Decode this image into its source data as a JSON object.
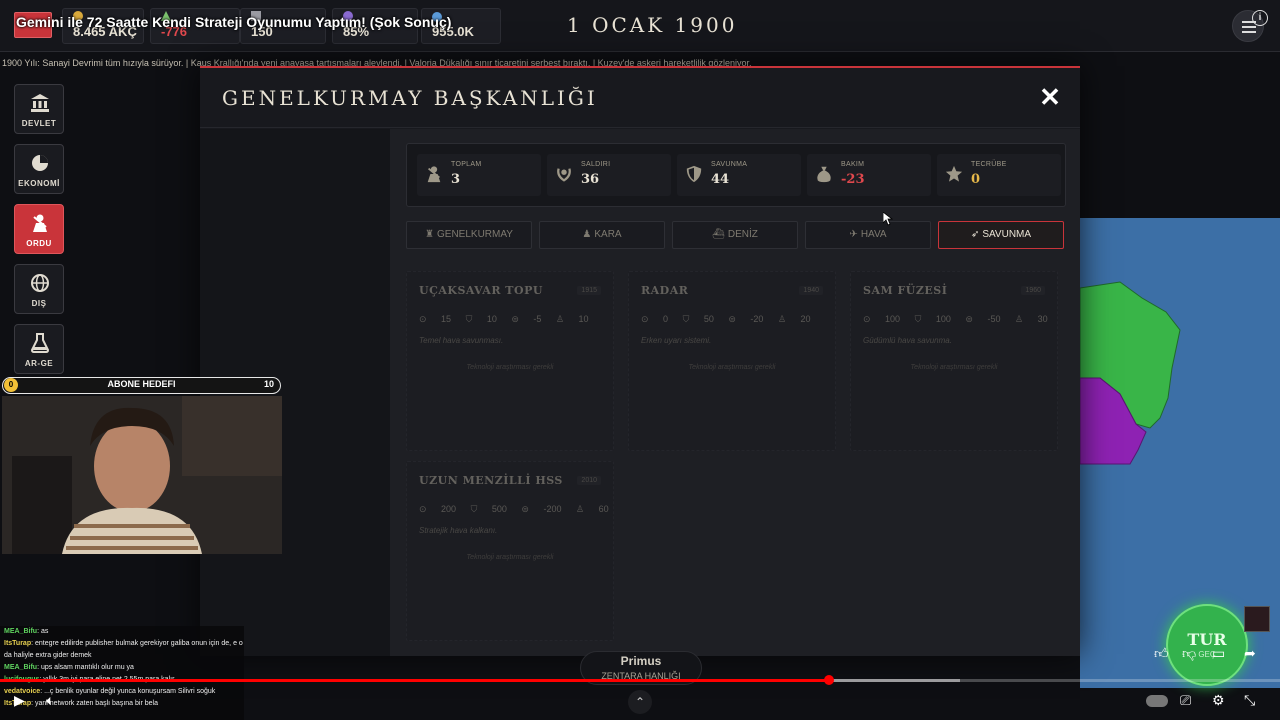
{
  "video": {
    "title": "Gemini ile 72 Saatte Kendi Strateji Oyunumu Yaptım! (Şok Sonuç)",
    "progress_percent": 65,
    "buffer_percent": 75
  },
  "topbar": {
    "resources": [
      {
        "icon": "coins-icon",
        "value": "8.465 AKÇ"
      },
      {
        "icon": "trend-icon",
        "value": "-776"
      },
      {
        "icon": "factory-icon",
        "value": "150"
      },
      {
        "icon": "population-icon",
        "value": "85%"
      },
      {
        "icon": "people-icon",
        "value": "955.0K"
      }
    ],
    "date": "1 OCAK 1900"
  },
  "ticker": "1900 Yılı: Sanayi Devrimi tüm hızıyla sürüyor. | Kaus Krallığı'nda yeni anayasa tartışmaları alevlendi. | Valoria Dükalığı sınır ticaretini serbest bıraktı. | Kuzey'de askeri hareketlilik gözleniyor.",
  "sidebar": {
    "items": [
      {
        "label": "DEVLET",
        "icon": "bank-icon"
      },
      {
        "label": "EKONOMİ",
        "icon": "pie-chart-icon"
      },
      {
        "label": "ORDU",
        "icon": "soldier-icon",
        "active": true
      },
      {
        "label": "DIŞ",
        "icon": "globe-icon"
      },
      {
        "label": "AR-GE",
        "icon": "flask-icon"
      }
    ]
  },
  "modal": {
    "title": "GENELKURMAY BAŞKANLIĞI",
    "close_symbol": "✕",
    "stats": [
      {
        "label": "TOPLAM",
        "value": "3",
        "icon": "soldier-icon",
        "color": "#e8e2d4"
      },
      {
        "label": "SALDIRI",
        "value": "36",
        "icon": "wreath-icon",
        "color": "#e8e2d4"
      },
      {
        "label": "SAVUNMA",
        "value": "44",
        "icon": "shield-icon",
        "color": "#e8e2d4"
      },
      {
        "label": "BAKIM",
        "value": "-23",
        "icon": "money-bag-icon",
        "color": "#e0484d"
      },
      {
        "label": "TECRÜBE",
        "value": "0",
        "icon": "star-icon",
        "color": "#e6b84a"
      }
    ],
    "tabs": [
      {
        "label": "GENELKURMAY",
        "icon": "chess-icon"
      },
      {
        "label": "KARA",
        "icon": "soldier-icon"
      },
      {
        "label": "DENİZ",
        "icon": "ship-icon"
      },
      {
        "label": "HAVA",
        "icon": "plane-icon"
      },
      {
        "label": "SAVUNMA",
        "icon": "rocket-icon",
        "active": true
      }
    ],
    "units": [
      {
        "name": "UÇAKSAVAR TOPU",
        "year": "1915",
        "attack": "15",
        "defense": "10",
        "cost": "-5",
        "manpower": "10",
        "desc": "Temel hava savunması.",
        "lock": "Teknoloji araştırması gerekli"
      },
      {
        "name": "RADAR",
        "year": "1940",
        "attack": "0",
        "defense": "50",
        "cost": "-20",
        "manpower": "20",
        "desc": "Erken uyarı sistemi.",
        "lock": "Teknoloji araştırması gerekli"
      },
      {
        "name": "SAM FÜZESİ",
        "year": "1960",
        "attack": "100",
        "defense": "100",
        "cost": "-50",
        "manpower": "30",
        "desc": "Güdümlü hava savunma.",
        "lock": "Teknoloji araştırması gerekli"
      },
      {
        "name": "UZUN MENZİLLİ HSS",
        "year": "2010",
        "attack": "200",
        "defense": "500",
        "cost": "-200",
        "manpower": "60",
        "desc": "Stratejik hava kalkanı.",
        "lock": "Teknoloji araştırması gerekli"
      }
    ]
  },
  "goal": {
    "start": "0",
    "label": "ABONE HEDEFI",
    "end": "10"
  },
  "chat": [
    {
      "user": "MEA_Bifu",
      "text": ": as"
    },
    {
      "user": "ItsTurap",
      "text": ": entegre edilirde publisher bulmak gerekiyor galiba onun için de, e o da haliyle extra gider demek"
    },
    {
      "user": "MEA_Bifu",
      "text": ": ups alsam mantıklı olur mu ya"
    },
    {
      "user": "lucifougus",
      "text": ": yıllık 3m iyi para eline net 2.55m para kalır"
    },
    {
      "user": "vedatvoice",
      "text": ": ...ç benlik oyunlar değil yunca konuşursam Silivri soğuk"
    },
    {
      "user": "ItsTurap",
      "text": ": yani network zaten başlı başına bir bela"
    }
  ],
  "bottom": {
    "unit_name": "Primus",
    "unit_sub": "ZENTARA HANLIĞI",
    "tur_label": "TUR",
    "tur_sub": "GEÇ"
  },
  "colors": {
    "accent": "#c9343a",
    "turn_button": "#33b24d",
    "map_sea": "#3c6fa6",
    "map_green": "#39b548",
    "map_purple": "#8e22b3"
  }
}
